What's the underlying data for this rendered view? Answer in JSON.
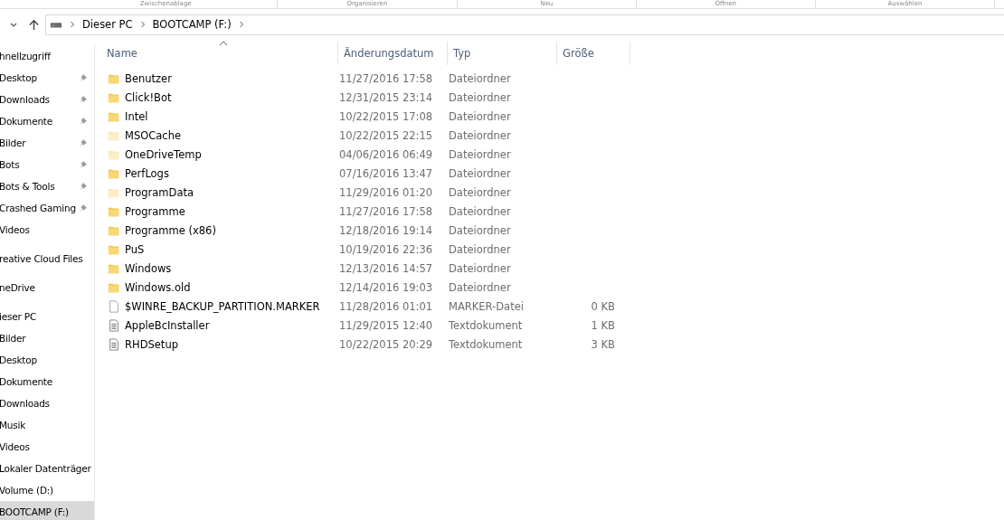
{
  "ribbon_groups": [
    "Zwischenablage",
    "Organisieren",
    "Neu",
    "Öffnen",
    "Auswählen"
  ],
  "address_bar": {
    "path": [
      "Dieser PC",
      "BOOTCAMP (F:)"
    ]
  },
  "sidebar": {
    "items": [
      {
        "kind": "section",
        "label": "hnellzugriff",
        "pinned": false,
        "selected": false
      },
      {
        "kind": "item",
        "label": "Desktop",
        "pinned": true,
        "selected": false
      },
      {
        "kind": "item",
        "label": "Downloads",
        "pinned": true,
        "selected": false
      },
      {
        "kind": "item",
        "label": "Dokumente",
        "pinned": true,
        "selected": false
      },
      {
        "kind": "item",
        "label": "Bilder",
        "pinned": true,
        "selected": false
      },
      {
        "kind": "item",
        "label": "Bots",
        "pinned": true,
        "selected": false
      },
      {
        "kind": "item",
        "label": "Bots & Tools",
        "pinned": true,
        "selected": false
      },
      {
        "kind": "item",
        "label": "Crashed Gaming",
        "pinned": true,
        "selected": false
      },
      {
        "kind": "item",
        "label": "Videos",
        "pinned": false,
        "selected": false
      },
      {
        "kind": "section",
        "label": "reative Cloud Files",
        "pinned": false,
        "selected": false
      },
      {
        "kind": "section",
        "label": "neDrive",
        "pinned": false,
        "selected": false
      },
      {
        "kind": "section",
        "label": "ieser PC",
        "pinned": false,
        "selected": false
      },
      {
        "kind": "item",
        "label": "Bilder",
        "pinned": false,
        "selected": false
      },
      {
        "kind": "item",
        "label": "Desktop",
        "pinned": false,
        "selected": false
      },
      {
        "kind": "item",
        "label": "Dokumente",
        "pinned": false,
        "selected": false
      },
      {
        "kind": "item",
        "label": "Downloads",
        "pinned": false,
        "selected": false
      },
      {
        "kind": "item",
        "label": "Musik",
        "pinned": false,
        "selected": false
      },
      {
        "kind": "item",
        "label": "Videos",
        "pinned": false,
        "selected": false
      },
      {
        "kind": "item",
        "label": "Lokaler Datenträger",
        "pinned": false,
        "selected": false
      },
      {
        "kind": "item",
        "label": "Volume (D:)",
        "pinned": false,
        "selected": false
      },
      {
        "kind": "item",
        "label": "BOOTCAMP (F:)",
        "pinned": false,
        "selected": true
      }
    ]
  },
  "table": {
    "columns": [
      "Name",
      "Änderungsdatum",
      "Typ",
      "Größe"
    ],
    "rows": [
      {
        "kind": "folder",
        "hidden": false,
        "name": "Benutzer",
        "date": "11/27/2016 17:58",
        "type": "Dateiordner"
      },
      {
        "kind": "folder",
        "hidden": false,
        "name": "Click!Bot",
        "date": "12/31/2015 23:14",
        "type": "Dateiordner"
      },
      {
        "kind": "folder",
        "hidden": false,
        "name": "Intel",
        "date": "10/22/2015 17:08",
        "type": "Dateiordner"
      },
      {
        "kind": "folder",
        "hidden": true,
        "name": "MSOCache",
        "date": "10/22/2015 22:15",
        "type": "Dateiordner"
      },
      {
        "kind": "folder",
        "hidden": true,
        "name": "OneDriveTemp",
        "date": "04/06/2016 06:49",
        "type": "Dateiordner"
      },
      {
        "kind": "folder",
        "hidden": false,
        "name": "PerfLogs",
        "date": "07/16/2016 13:47",
        "type": "Dateiordner"
      },
      {
        "kind": "folder",
        "hidden": true,
        "name": "ProgramData",
        "date": "11/29/2016 01:20",
        "type": "Dateiordner"
      },
      {
        "kind": "folder",
        "hidden": false,
        "name": "Programme",
        "date": "11/27/2016 17:58",
        "type": "Dateiordner"
      },
      {
        "kind": "folder",
        "hidden": false,
        "name": "Programme (x86)",
        "date": "12/18/2016 19:14",
        "type": "Dateiordner"
      },
      {
        "kind": "folder",
        "hidden": false,
        "name": "PuS",
        "date": "10/19/2016 22:36",
        "type": "Dateiordner"
      },
      {
        "kind": "folder",
        "hidden": false,
        "name": "Windows",
        "date": "12/13/2016 14:57",
        "type": "Dateiordner"
      },
      {
        "kind": "folder",
        "hidden": false,
        "name": "Windows.old",
        "date": "12/14/2016 19:03",
        "type": "Dateiordner"
      },
      {
        "kind": "file",
        "hidden": false,
        "name": "$WINRE_BACKUP_PARTITION.MARKER",
        "date": "11/28/2016 01:01",
        "type": "MARKER-Datei",
        "size": "0 KB"
      },
      {
        "kind": "text",
        "hidden": false,
        "name": "AppleBcInstaller",
        "date": "11/29/2015 12:40",
        "type": "Textdokument",
        "size": "1 KB"
      },
      {
        "kind": "text",
        "hidden": false,
        "name": "RHDSetup",
        "date": "10/22/2015 20:29",
        "type": "Textdokument",
        "size": "3 KB"
      }
    ]
  }
}
